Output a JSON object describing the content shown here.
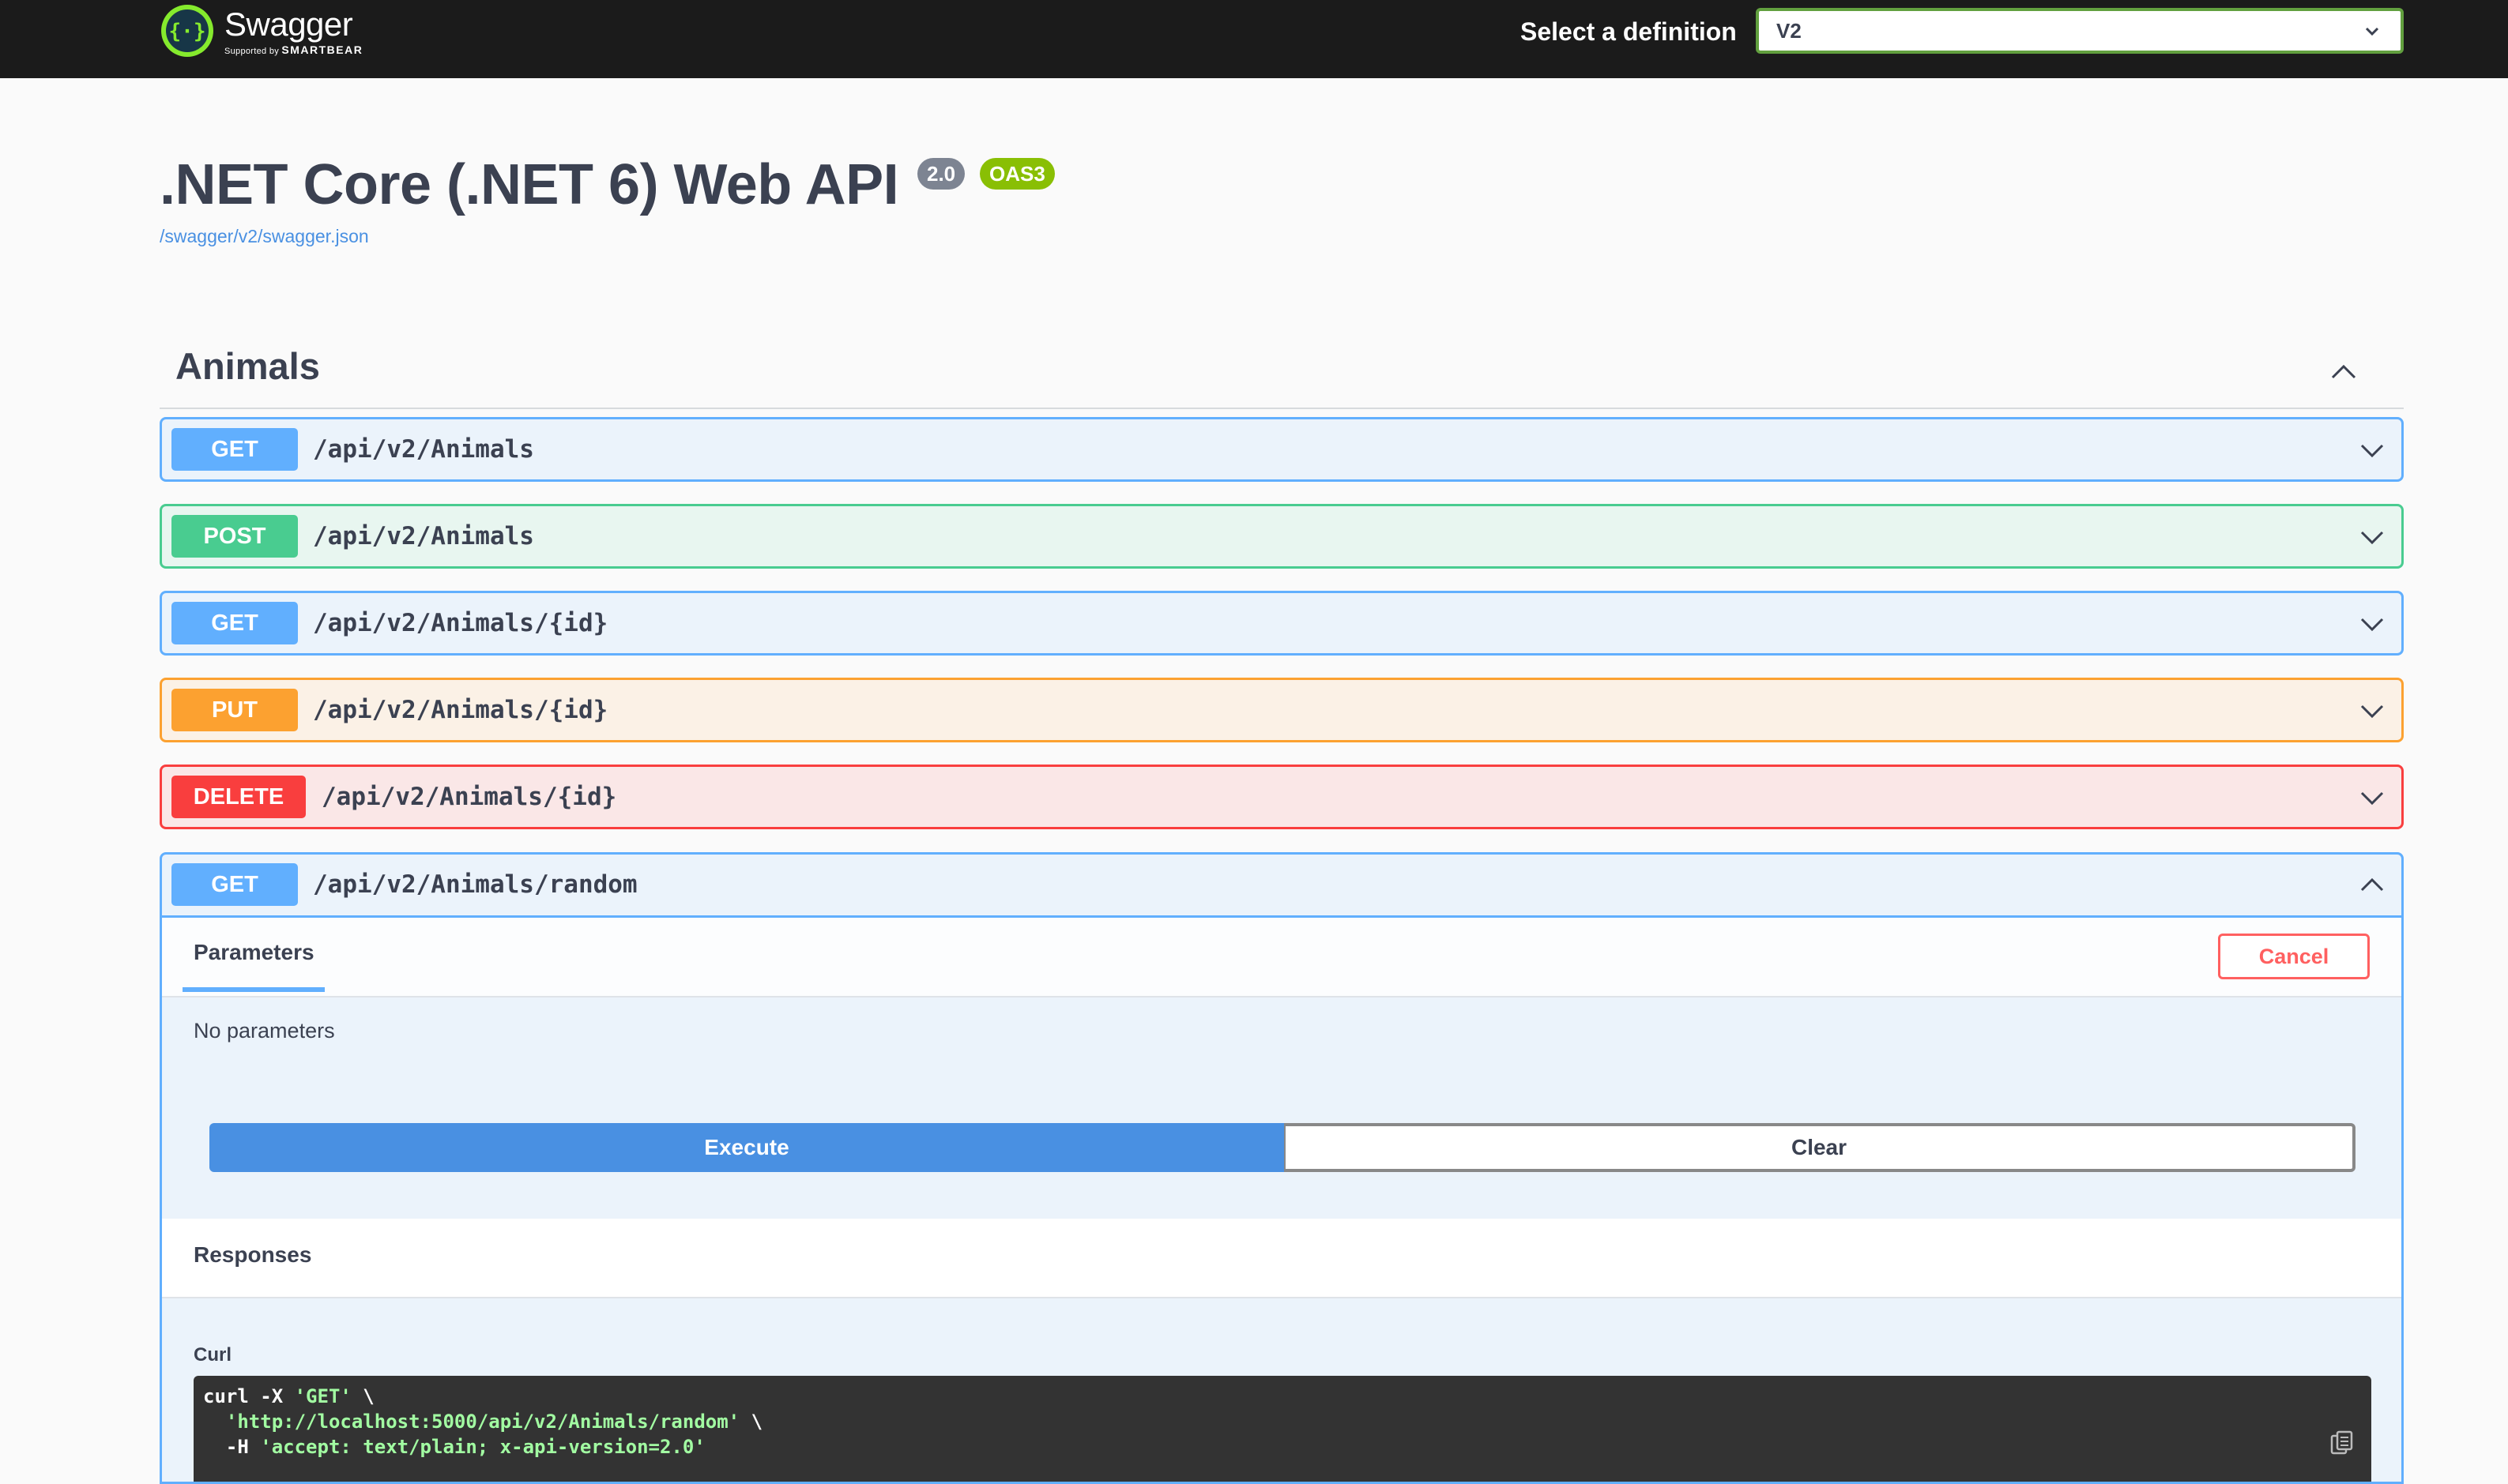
{
  "topbar": {
    "logo_name": "Swagger",
    "logo_sub_prefix": "Supported by",
    "logo_sub_brand": "SMARTBEAR",
    "definition_label": "Select a definition",
    "definition_value": "V2"
  },
  "info": {
    "title": ".NET Core (.NET 6) Web API",
    "version_badge": "2.0",
    "oas_badge": "OAS3",
    "spec_link": "/swagger/v2/swagger.json"
  },
  "tag": {
    "name": "Animals"
  },
  "operations": [
    {
      "method": "GET",
      "path": "/api/v2/Animals"
    },
    {
      "method": "POST",
      "path": "/api/v2/Animals"
    },
    {
      "method": "GET",
      "path": "/api/v2/Animals/{id}"
    },
    {
      "method": "PUT",
      "path": "/api/v2/Animals/{id}"
    },
    {
      "method": "DELETE",
      "path": "/api/v2/Animals/{id}"
    },
    {
      "method": "GET",
      "path": "/api/v2/Animals/random"
    }
  ],
  "expanded": {
    "params_tab": "Parameters",
    "cancel_label": "Cancel",
    "no_params": "No parameters",
    "execute_label": "Execute",
    "clear_label": "Clear",
    "responses_title": "Responses",
    "curl_label": "Curl",
    "curl_line1_cmd": "curl -X ",
    "curl_line1_method": "'GET'",
    "curl_line1_end": " \\",
    "curl_line2_url": "'http://localhost:5000/api/v2/Animals/random'",
    "curl_line2_end": " \\",
    "curl_line3_flag": "  -H ",
    "curl_line3_header": "'accept: text/plain; x-api-version=2.0'"
  },
  "colors": {
    "get": "#61affe",
    "post": "#49cc90",
    "put": "#fca130",
    "delete": "#f93e3e",
    "topbar": "#1b1b1b",
    "execute": "#4990e2"
  },
  "icons": [
    "swagger-logo-icon",
    "chevron-down-icon",
    "chevron-up-icon",
    "copy-icon"
  ]
}
